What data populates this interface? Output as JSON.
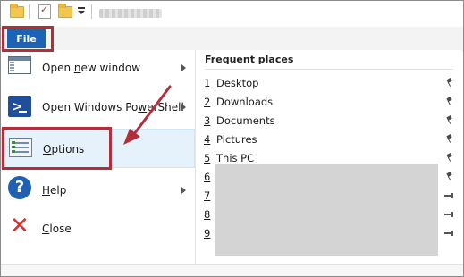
{
  "quick_access": {
    "title_blurred": true,
    "icons": [
      "folder-icon",
      "properties-icon",
      "new-folder-icon",
      "customize-qat-icon"
    ]
  },
  "ribbon": {
    "file_tab": "File"
  },
  "menu": {
    "items": [
      {
        "label_parts": [
          "Open ",
          "n",
          "ew window"
        ],
        "icon": "new-window-icon",
        "submenu": true
      },
      {
        "label_parts": [
          "Open Windows Po",
          "w",
          "erShell"
        ],
        "icon": "powershell-icon",
        "submenu": true
      },
      {
        "label_parts": [
          "",
          "O",
          "ptions"
        ],
        "icon": "options-icon",
        "submenu": false,
        "selected": true
      },
      {
        "label_parts": [
          "",
          "H",
          "elp"
        ],
        "icon": "help-icon",
        "submenu": true
      },
      {
        "label_parts": [
          "",
          "C",
          "lose"
        ],
        "icon": "close-icon",
        "submenu": false
      }
    ]
  },
  "frequent_places": {
    "title": "Frequent places",
    "items": [
      {
        "num": "1",
        "name": "Desktop"
      },
      {
        "num": "2",
        "name": "Downloads"
      },
      {
        "num": "3",
        "name": "Documents"
      },
      {
        "num": "4",
        "name": "Pictures"
      },
      {
        "num": "5",
        "name": "This PC"
      },
      {
        "num": "6",
        "name": ""
      },
      {
        "num": "7",
        "name": ""
      },
      {
        "num": "8",
        "name": ""
      },
      {
        "num": "9",
        "name": ""
      }
    ]
  },
  "annotation": {
    "highlight_color": "#b32d3a"
  }
}
